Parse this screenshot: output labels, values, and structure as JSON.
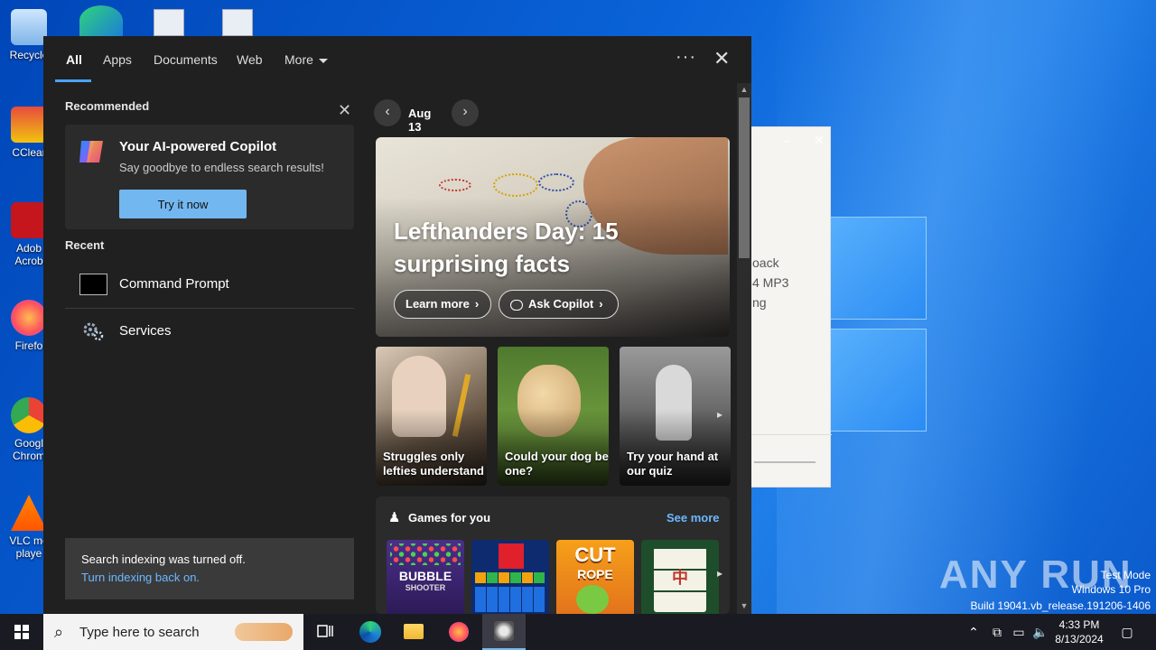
{
  "desktop": {
    "icons": [
      {
        "label": "Recycle"
      },
      {
        "label": "CClear"
      },
      {
        "label": "Adob Acrob"
      },
      {
        "label": "Firefo"
      },
      {
        "label": "Googl Chrom"
      },
      {
        "label": "VLC me playe"
      }
    ],
    "bg_window_lines": [
      "oack",
      "4 MP3",
      "ng"
    ],
    "watermark": "ANY RUN",
    "wm_lines": [
      "Test Mode",
      "Windows 10 Pro",
      "Build 19041.vb_release.191206-1406"
    ]
  },
  "search": {
    "tabs": [
      {
        "label": "All"
      },
      {
        "label": "Apps"
      },
      {
        "label": "Documents"
      },
      {
        "label": "Web"
      },
      {
        "label": "More"
      }
    ],
    "more_options": "···",
    "close": "✕"
  },
  "recommended": {
    "title": "Recommended",
    "close": "✕",
    "card": {
      "title": "Your AI-powered Copilot",
      "subtitle": "Say goodbye to endless search results!",
      "button": "Try it now"
    }
  },
  "recent": {
    "title": "Recent",
    "items": [
      {
        "label": "Command Prompt"
      },
      {
        "label": "Services"
      }
    ]
  },
  "indexing": {
    "message": "Search indexing was turned off.",
    "link": "Turn indexing back on."
  },
  "feed": {
    "prev": "‹",
    "next": "›",
    "date": "Aug 13",
    "hero": {
      "title": "Lefthanders Day: 15 surprising facts",
      "learn_more": "Learn more",
      "ask_copilot": "Ask Copilot",
      "chev": "›"
    },
    "cards": [
      {
        "caption": "Struggles only lefties understand"
      },
      {
        "caption": "Could your dog be one?"
      },
      {
        "caption": "Try your hand at our quiz"
      }
    ],
    "cards_next": "▸",
    "games": {
      "title": "Games for you",
      "see_more": "See more",
      "tiles": [
        {
          "name": "BUBBLE",
          "sub": "SHOOTER"
        },
        {
          "name": ""
        },
        {
          "name": "CUT",
          "sub": "ROPE"
        },
        {
          "name": ""
        }
      ],
      "next": "▸"
    }
  },
  "taskbar": {
    "search_placeholder": "Type here to search",
    "time": "4:33 PM",
    "date": "8/13/2024"
  }
}
